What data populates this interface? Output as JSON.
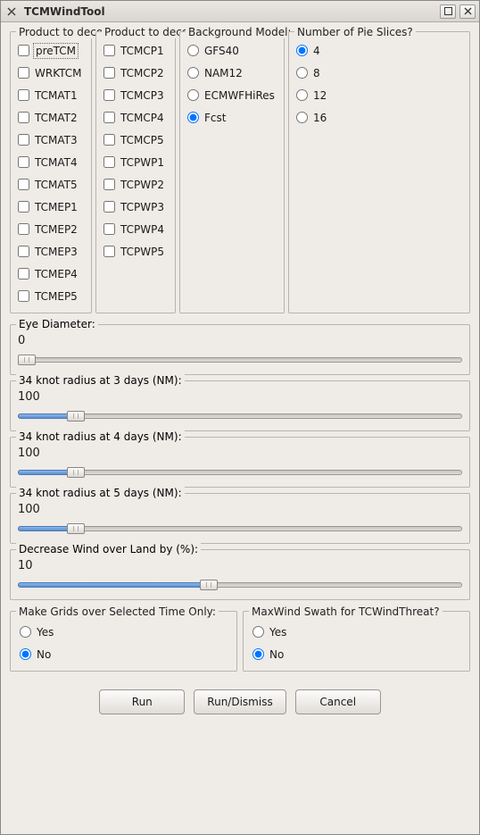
{
  "window": {
    "title": "TCMWindTool"
  },
  "groups": {
    "products1": {
      "legend": "Product to decode:",
      "items": [
        "preTCM",
        "WRKTCM",
        "TCMAT1",
        "TCMAT2",
        "TCMAT3",
        "TCMAT4",
        "TCMAT5",
        "TCMEP1",
        "TCMEP2",
        "TCMEP3",
        "TCMEP4",
        "TCMEP5"
      ]
    },
    "products2": {
      "legend": "Product to decode:",
      "items": [
        "TCMCP1",
        "TCMCP2",
        "TCMCP3",
        "TCMCP4",
        "TCMCP5",
        "TCPWP1",
        "TCPWP2",
        "TCPWP3",
        "TCPWP4",
        "TCPWP5"
      ]
    },
    "bgmodel": {
      "legend": "Background Model:",
      "options": [
        "GFS40",
        "NAM12",
        "ECMWFHiRes",
        "Fcst"
      ],
      "selected": "Fcst"
    },
    "pie": {
      "legend": "Number of Pie Slices?",
      "options": [
        "4",
        "8",
        "12",
        "16"
      ],
      "selected": "4"
    }
  },
  "sliders": {
    "eye": {
      "legend": "Eye Diameter:",
      "value": "0",
      "pct": 0
    },
    "r34d3": {
      "legend": "34 knot radius at 3 days (NM):",
      "value": "100",
      "pct": 13
    },
    "r34d4": {
      "legend": "34 knot radius at 4 days (NM):",
      "value": "100",
      "pct": 13
    },
    "r34d5": {
      "legend": "34 knot radius at 5 days (NM):",
      "value": "100",
      "pct": 13
    },
    "decw": {
      "legend": "Decrease Wind over Land by (%):",
      "value": "10",
      "pct": 43
    }
  },
  "bottom": {
    "grids": {
      "legend": "Make Grids over Selected Time Only:",
      "options": [
        "Yes",
        "No"
      ],
      "selected": "No"
    },
    "swath": {
      "legend": "MaxWind Swath for TCWindThreat?",
      "options": [
        "Yes",
        "No"
      ],
      "selected": "No"
    }
  },
  "buttons": {
    "run": "Run",
    "rundismiss": "Run/Dismiss",
    "cancel": "Cancel"
  }
}
